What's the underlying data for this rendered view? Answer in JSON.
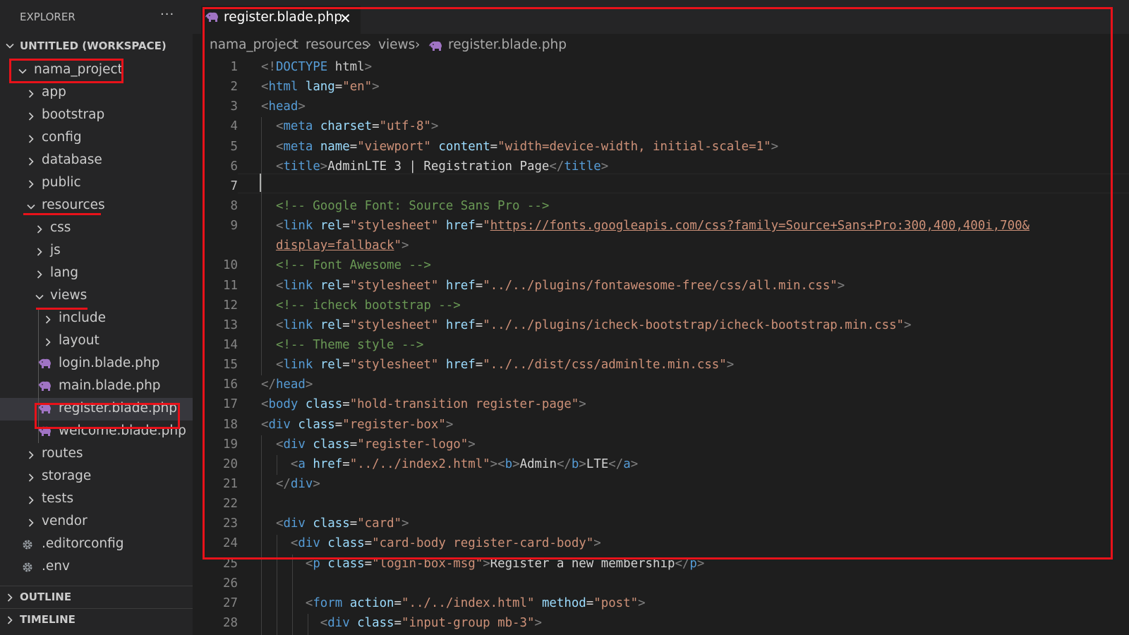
{
  "sidebar": {
    "header": "EXPLORER",
    "more": "···",
    "workspace": "UNTITLED (WORKSPACE)",
    "tree": [
      {
        "label": "nama_project",
        "kind": "folder",
        "open": true
      },
      {
        "label": "app",
        "kind": "folder",
        "open": false
      },
      {
        "label": "bootstrap",
        "kind": "folder",
        "open": false
      },
      {
        "label": "config",
        "kind": "folder",
        "open": false
      },
      {
        "label": "database",
        "kind": "folder",
        "open": false
      },
      {
        "label": "public",
        "kind": "folder",
        "open": false
      },
      {
        "label": "resources",
        "kind": "folder",
        "open": true
      },
      {
        "label": "css",
        "kind": "folder",
        "open": false
      },
      {
        "label": "js",
        "kind": "folder",
        "open": false
      },
      {
        "label": "lang",
        "kind": "folder",
        "open": false
      },
      {
        "label": "views",
        "kind": "folder",
        "open": true
      },
      {
        "label": "include",
        "kind": "folder",
        "open": false
      },
      {
        "label": "layout",
        "kind": "folder",
        "open": false
      },
      {
        "label": "login.blade.php",
        "kind": "php"
      },
      {
        "label": "main.blade.php",
        "kind": "php"
      },
      {
        "label": "register.blade.php",
        "kind": "php",
        "selected": true
      },
      {
        "label": "welcome.blade.php",
        "kind": "php"
      },
      {
        "label": "routes",
        "kind": "folder",
        "open": false
      },
      {
        "label": "storage",
        "kind": "folder",
        "open": false
      },
      {
        "label": "tests",
        "kind": "folder",
        "open": false
      },
      {
        "label": "vendor",
        "kind": "folder",
        "open": false
      },
      {
        "label": ".editorconfig",
        "kind": "gear"
      },
      {
        "label": ".env",
        "kind": "gear"
      }
    ],
    "outline": "OUTLINE",
    "timeline": "TIMELINE"
  },
  "editor": {
    "tab_label": "register.blade.php",
    "close_glyph": "✕",
    "breadcrumb": [
      "nama_project",
      "resources",
      "views",
      "register.blade.php"
    ],
    "breadcrumb_sep": "›",
    "lines": [
      {
        "n": "1",
        "text": "<!DOCTYPE html>"
      },
      {
        "n": "2",
        "text": "<html lang=\"en\">"
      },
      {
        "n": "3",
        "text": "<head>"
      },
      {
        "n": "4",
        "text": "  <meta charset=\"utf-8\">"
      },
      {
        "n": "5",
        "text": "  <meta name=\"viewport\" content=\"width=device-width, initial-scale=1\">"
      },
      {
        "n": "6",
        "text": "  <title>AdminLTE 3 | Registration Page</title>"
      },
      {
        "n": "7",
        "text": ""
      },
      {
        "n": "8",
        "text": "  <!-- Google Font: Source Sans Pro -->"
      },
      {
        "n": "9",
        "text": "  <link rel=\"stylesheet\" href=\"https://fonts.googleapis.com/css?family=Source+Sans+Pro:300,400,400i,700&"
      },
      {
        "n": "",
        "text": "  display=fallback\">"
      },
      {
        "n": "10",
        "text": "  <!-- Font Awesome -->"
      },
      {
        "n": "11",
        "text": "  <link rel=\"stylesheet\" href=\"../../plugins/fontawesome-free/css/all.min.css\">"
      },
      {
        "n": "12",
        "text": "  <!-- icheck bootstrap -->"
      },
      {
        "n": "13",
        "text": "  <link rel=\"stylesheet\" href=\"../../plugins/icheck-bootstrap/icheck-bootstrap.min.css\">"
      },
      {
        "n": "14",
        "text": "  <!-- Theme style -->"
      },
      {
        "n": "15",
        "text": "  <link rel=\"stylesheet\" href=\"../../dist/css/adminlte.min.css\">"
      },
      {
        "n": "16",
        "text": "</head>"
      },
      {
        "n": "17",
        "text": "<body class=\"hold-transition register-page\">"
      },
      {
        "n": "18",
        "text": "<div class=\"register-box\">"
      },
      {
        "n": "19",
        "text": "  <div class=\"register-logo\">"
      },
      {
        "n": "20",
        "text": "    <a href=\"../../index2.html\"><b>Admin</b>LTE</a>"
      },
      {
        "n": "21",
        "text": "  </div>"
      },
      {
        "n": "22",
        "text": ""
      },
      {
        "n": "23",
        "text": "  <div class=\"card\">"
      },
      {
        "n": "24",
        "text": "    <div class=\"card-body register-card-body\">"
      },
      {
        "n": "25",
        "text": "      <p class=\"login-box-msg\">Register a new membership</p>"
      },
      {
        "n": "26",
        "text": ""
      },
      {
        "n": "27",
        "text": "      <form action=\"../../index.html\" method=\"post\">"
      },
      {
        "n": "28",
        "text": "        <div class=\"input-group mb-3\">"
      }
    ],
    "current_line": "7"
  },
  "colors": {
    "annotation_red": "#e8121a",
    "php_icon": "#a074c4"
  }
}
